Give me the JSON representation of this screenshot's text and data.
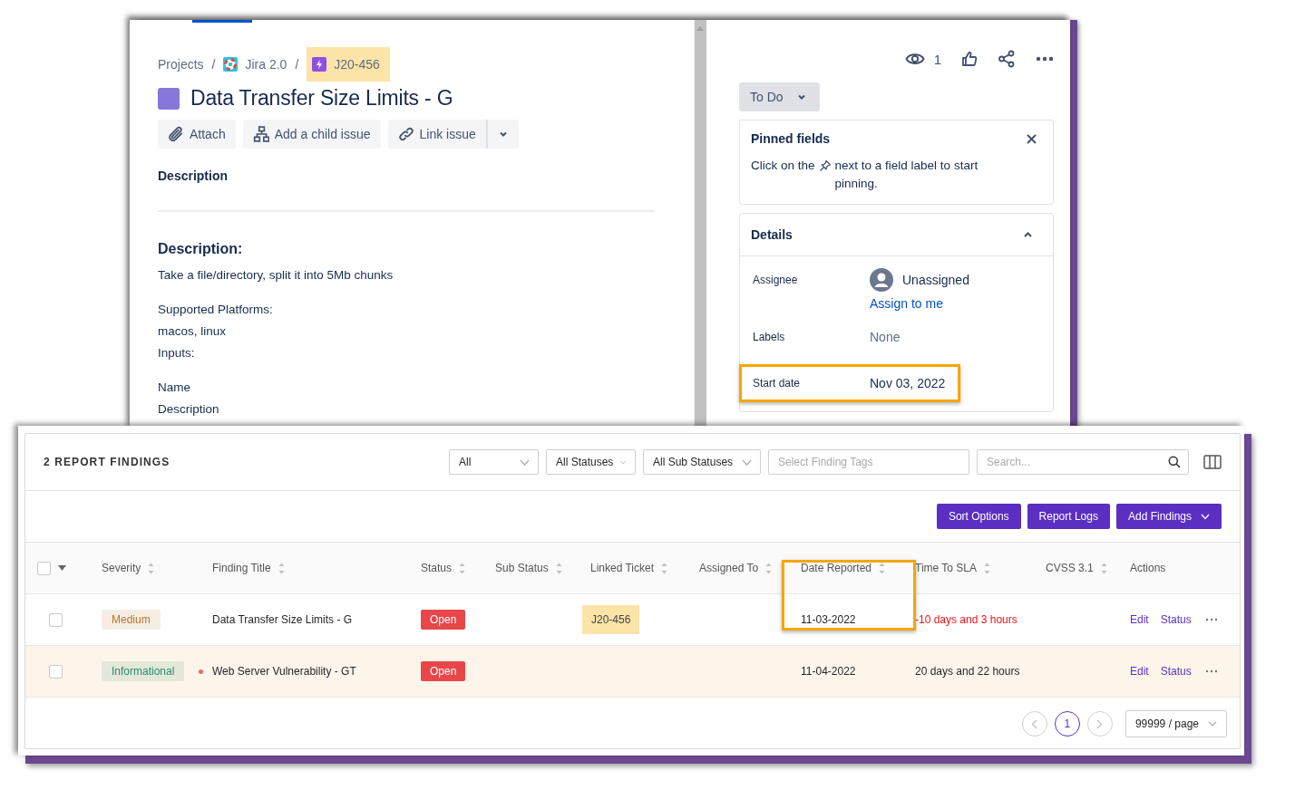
{
  "issue_window": {
    "breadcrumbs": [
      {
        "label": "Projects",
        "kind": "text",
        "highlighted": false
      },
      {
        "separator": "/",
        "label": "Jira 2.0",
        "kind": "project",
        "highlighted": false
      },
      {
        "separator": "/",
        "label": "J20-456",
        "kind": "issue",
        "highlighted": true
      }
    ],
    "title": "Data Transfer Size Limits - G",
    "actions": [
      {
        "label": "Attach",
        "kind": "attach"
      },
      {
        "label": "Add a child issue",
        "kind": "child"
      },
      {
        "label": "Link issue",
        "kind": "link"
      }
    ],
    "description_label": "Description",
    "description": [
      {
        "kind": "heading",
        "text": "Description:"
      },
      {
        "kind": "para",
        "text": "Take a file/directory, split it into 5Mb chunks"
      },
      {
        "kind": "para",
        "text": "Supported Platforms:"
      },
      {
        "kind": "line",
        "text": "macos, linux"
      },
      {
        "kind": "line",
        "text": "Inputs:"
      },
      {
        "kind": "para",
        "text": "Name"
      },
      {
        "kind": "line",
        "text": "Description"
      }
    ],
    "watchers": "1",
    "status_button": "To Do",
    "pinned": {
      "title": "Pinned fields",
      "text_before": "Click on the",
      "text_after": "next to a field label to start pinning."
    },
    "details": {
      "title": "Details",
      "expanded": true,
      "fields": [
        {
          "label": "Assignee",
          "kind": "user",
          "value": "Unassigned",
          "action": "Assign to me",
          "highlighted": false
        },
        {
          "label": "Labels",
          "kind": "empty",
          "value": "None",
          "highlighted": false
        },
        {
          "label": "Start date",
          "kind": "date",
          "value": "Nov 03, 2022",
          "highlighted": true
        }
      ]
    }
  },
  "findings_window": {
    "title": "2 REPORT FINDINGS",
    "filters": [
      {
        "kind": "select",
        "value": "All"
      },
      {
        "kind": "select",
        "value": "All Statuses"
      },
      {
        "kind": "select",
        "value": "All Sub Statuses"
      },
      {
        "kind": "tags",
        "placeholder": "Select Finding Tags"
      },
      {
        "kind": "search",
        "placeholder": "Search..."
      }
    ],
    "buttons": [
      {
        "kind": "plain",
        "label": "Sort Options"
      },
      {
        "kind": "plain",
        "label": "Report Logs"
      },
      {
        "kind": "dropdown",
        "label": "Add Findings"
      }
    ],
    "table": {
      "select_all_checked": false,
      "columns": [
        {
          "label": "Severity",
          "sortable": true
        },
        {
          "label": "Finding Title",
          "sortable": true
        },
        {
          "label": "Status",
          "sortable": true
        },
        {
          "label": "Sub Status",
          "sortable": true
        },
        {
          "label": "Linked Ticket",
          "sortable": true
        },
        {
          "label": "Assigned To",
          "sortable": true
        },
        {
          "label": "Date Reported",
          "sortable": true
        },
        {
          "label": "Time To SLA",
          "sortable": true
        },
        {
          "label": "CVSS 3.1",
          "sortable": true
        },
        {
          "label": "Actions",
          "sortable": false
        }
      ],
      "rows": [
        {
          "checked": false,
          "hovered": false,
          "severity": {
            "label": "Medium",
            "color": "#b8732a"
          },
          "dot": false,
          "title": "Data Transfer Size Limits - G",
          "status": "Open",
          "linked_ticket": "J20-456",
          "ticket_highlighted": true,
          "date_reported": "11-03-2022",
          "date_highlighted": true,
          "time_to_sla": "-10 days and 3 hours",
          "overdue": true,
          "actions": [
            "Edit",
            "Status"
          ]
        },
        {
          "checked": false,
          "hovered": true,
          "severity": {
            "label": "Informational",
            "color": "#2a8a6e"
          },
          "dot": true,
          "title": "Web Server Vulnerability - GT",
          "status": "Open",
          "date_reported": "11-04-2022",
          "date_highlighted": false,
          "time_to_sla": "20 days and 22 hours",
          "overdue": false,
          "actions": [
            "Edit",
            "Status"
          ]
        }
      ]
    },
    "pagination": {
      "pages": [
        {
          "label": "1",
          "selected": true
        }
      ],
      "page_size": "99999 / page"
    }
  }
}
